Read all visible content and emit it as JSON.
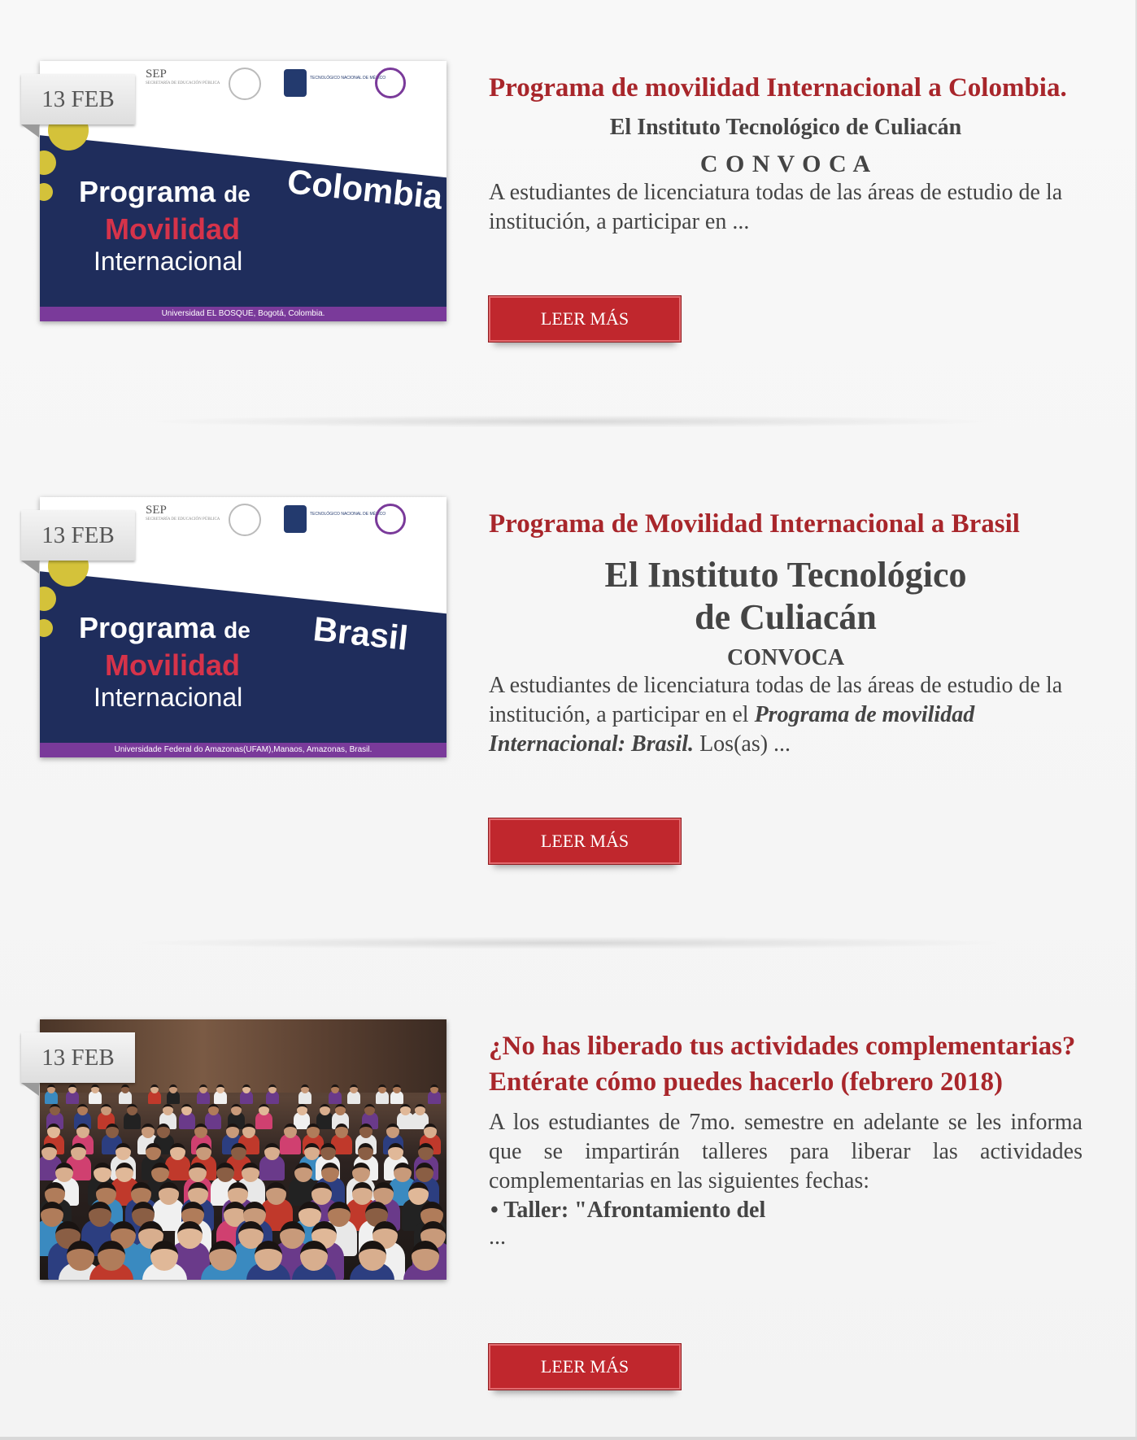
{
  "posts": [
    {
      "date": "13 FEB",
      "title": "Programa de movilidad Internacional a Colombia.",
      "institution": "El Instituto Tecnológico de Culiacán",
      "convoca": "C O N V O C A",
      "excerpt": "A estudiantes de licenciatura todas de las áreas de estudio de la institución, a participar en ...",
      "button": "LEER MÁS",
      "image": {
        "line1a": "Programa",
        "line1b": "de",
        "line2": "Movilidad",
        "line3": "Internacional",
        "country": "Colombia",
        "footer": "Universidad EL BOSQUE, Bogotá, Colombia.",
        "sep": "SEP",
        "sep_sub": "SECRETARÍA DE EDUCACIÓN PÚBLICA",
        "tec_sub": "TECNOLÓGICO NACIONAL DE MÉXICO"
      }
    },
    {
      "date": "13 FEB",
      "title": "Programa de Movilidad Internacional a Brasil",
      "institution_line1": "El Instituto Tecnológico",
      "institution_line2": "de Culiacán",
      "convoca": "CONVOCA",
      "excerpt_a": "A estudiantes de licenciatura todas de las áreas de estudio de la institución, a participar en el ",
      "excerpt_em": "Programa de movilidad Internacional: Brasil.",
      "excerpt_b": " Los(as) ...",
      "button": "LEER MÁS",
      "image": {
        "line1a": "Programa",
        "line1b": "de",
        "line2": "Movilidad",
        "line3": "Internacional",
        "country": "Brasil",
        "footer": "Universidade Federal do Amazonas(UFAM),Manaos, Amazonas, Brasil.",
        "sep": "SEP",
        "sep_sub": "SECRETARÍA DE EDUCACIÓN PÚBLICA",
        "tec_sub": "TECNOLÓGICO NACIONAL DE MÉXICO"
      }
    },
    {
      "date": "13 FEB",
      "title": "¿No has liberado tus actividades complementarias? Entérate cómo puedes hacerlo (febrero 2018)",
      "excerpt": "A los estudiantes de 7mo. semestre en adelante se les informa que se impartirán talleres para liberar las actividades complementarias en las siguientes fechas:",
      "bullet": "Taller: \"Afrontamiento del",
      "ellipsis": "...",
      "button": "LEER MÁS"
    }
  ],
  "colors": {
    "title": "#a8262b",
    "button": "#c0272d",
    "navy": "#1f2d5c",
    "purple": "#7a3a9a"
  }
}
